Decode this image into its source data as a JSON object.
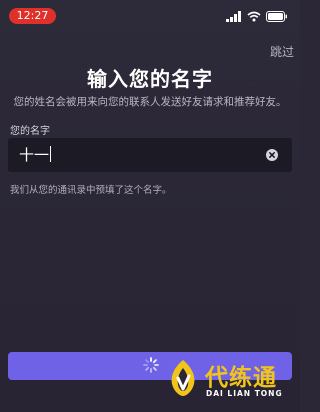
{
  "status_bar": {
    "time": "12:27",
    "time_pill_color": "#e0302a",
    "icons": [
      "signal-icon",
      "wifi-icon",
      "battery-icon"
    ]
  },
  "header": {
    "skip_label": "跳过"
  },
  "main": {
    "title": "输入您的名字",
    "subtitle": "您的姓名会被用来向您的联系人发送好友请求和推荐好友。",
    "field_label": "您的名字",
    "input_value": "十一",
    "input_icon": "clear-icon",
    "hint": "我们从您的通讯录中预填了这个名字。"
  },
  "footer": {
    "button_state": "loading",
    "button_icon": "spinner-icon",
    "button_color": "#6f62e6"
  },
  "watermark": {
    "cn": "代练通",
    "en": "DAI LIAN TONG"
  }
}
